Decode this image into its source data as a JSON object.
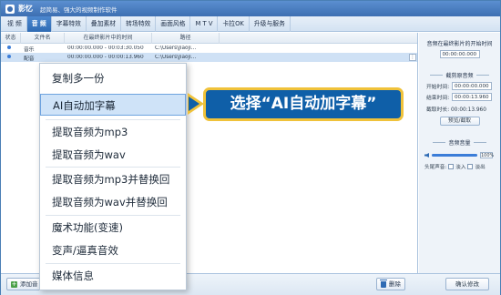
{
  "app": {
    "name": "影忆",
    "slogan": "超简易、强大的视频制作软件"
  },
  "tabs": [
    {
      "label": "视 频"
    },
    {
      "label": "音 频"
    },
    {
      "label": "字幕特效"
    },
    {
      "label": "叠加素材"
    },
    {
      "label": "转场特效"
    },
    {
      "label": "画面风格"
    },
    {
      "label": "M T V"
    },
    {
      "label": "卡拉OK"
    },
    {
      "label": "升级与服务"
    }
  ],
  "active_tab": "音 频",
  "table": {
    "columns": [
      "状态",
      "文件名",
      "在最终影片中的时间",
      "路径"
    ],
    "rows": [
      {
        "name": "音乐",
        "time": "00:00:00.000 - 00:03:30.050",
        "path": "C:\\Users\\Jiaoji..."
      },
      {
        "name": "配音",
        "time": "00:00:00.000 - 00:00:13.960",
        "path": "C:\\Users\\Jiaoji..."
      }
    ]
  },
  "menu": {
    "items": [
      "复制多一份",
      "AI自动加字幕",
      "提取音频为mp3",
      "提取音频为wav",
      "提取音频为mp3并替换回",
      "提取音频为wav并替换回",
      "魔术功能(变速)",
      "变声/逼真音效",
      "媒体信息"
    ]
  },
  "callout": {
    "text": "选择“AI自动加字幕”"
  },
  "side": {
    "title": "音频在最终影片的开始时间",
    "start_value": "00:00:00.000",
    "section_clip": "截剪原音频",
    "start_label": "开始时间:",
    "start_clip": "00:00:00.000",
    "end_label": "结束时间:",
    "end_clip": "00:00:13.960",
    "clip_length": "截取时长: 00:00:13.960",
    "preview_label": "预览/截取",
    "section_volume": "音频音量",
    "volume_value": "100%",
    "fade_label": "头尾声音:",
    "fade_in": "淡入",
    "fade_out": "淡出",
    "confirm_label": "确认修改"
  },
  "bottom": {
    "add_label": "添加音",
    "delete_label": "删除"
  }
}
